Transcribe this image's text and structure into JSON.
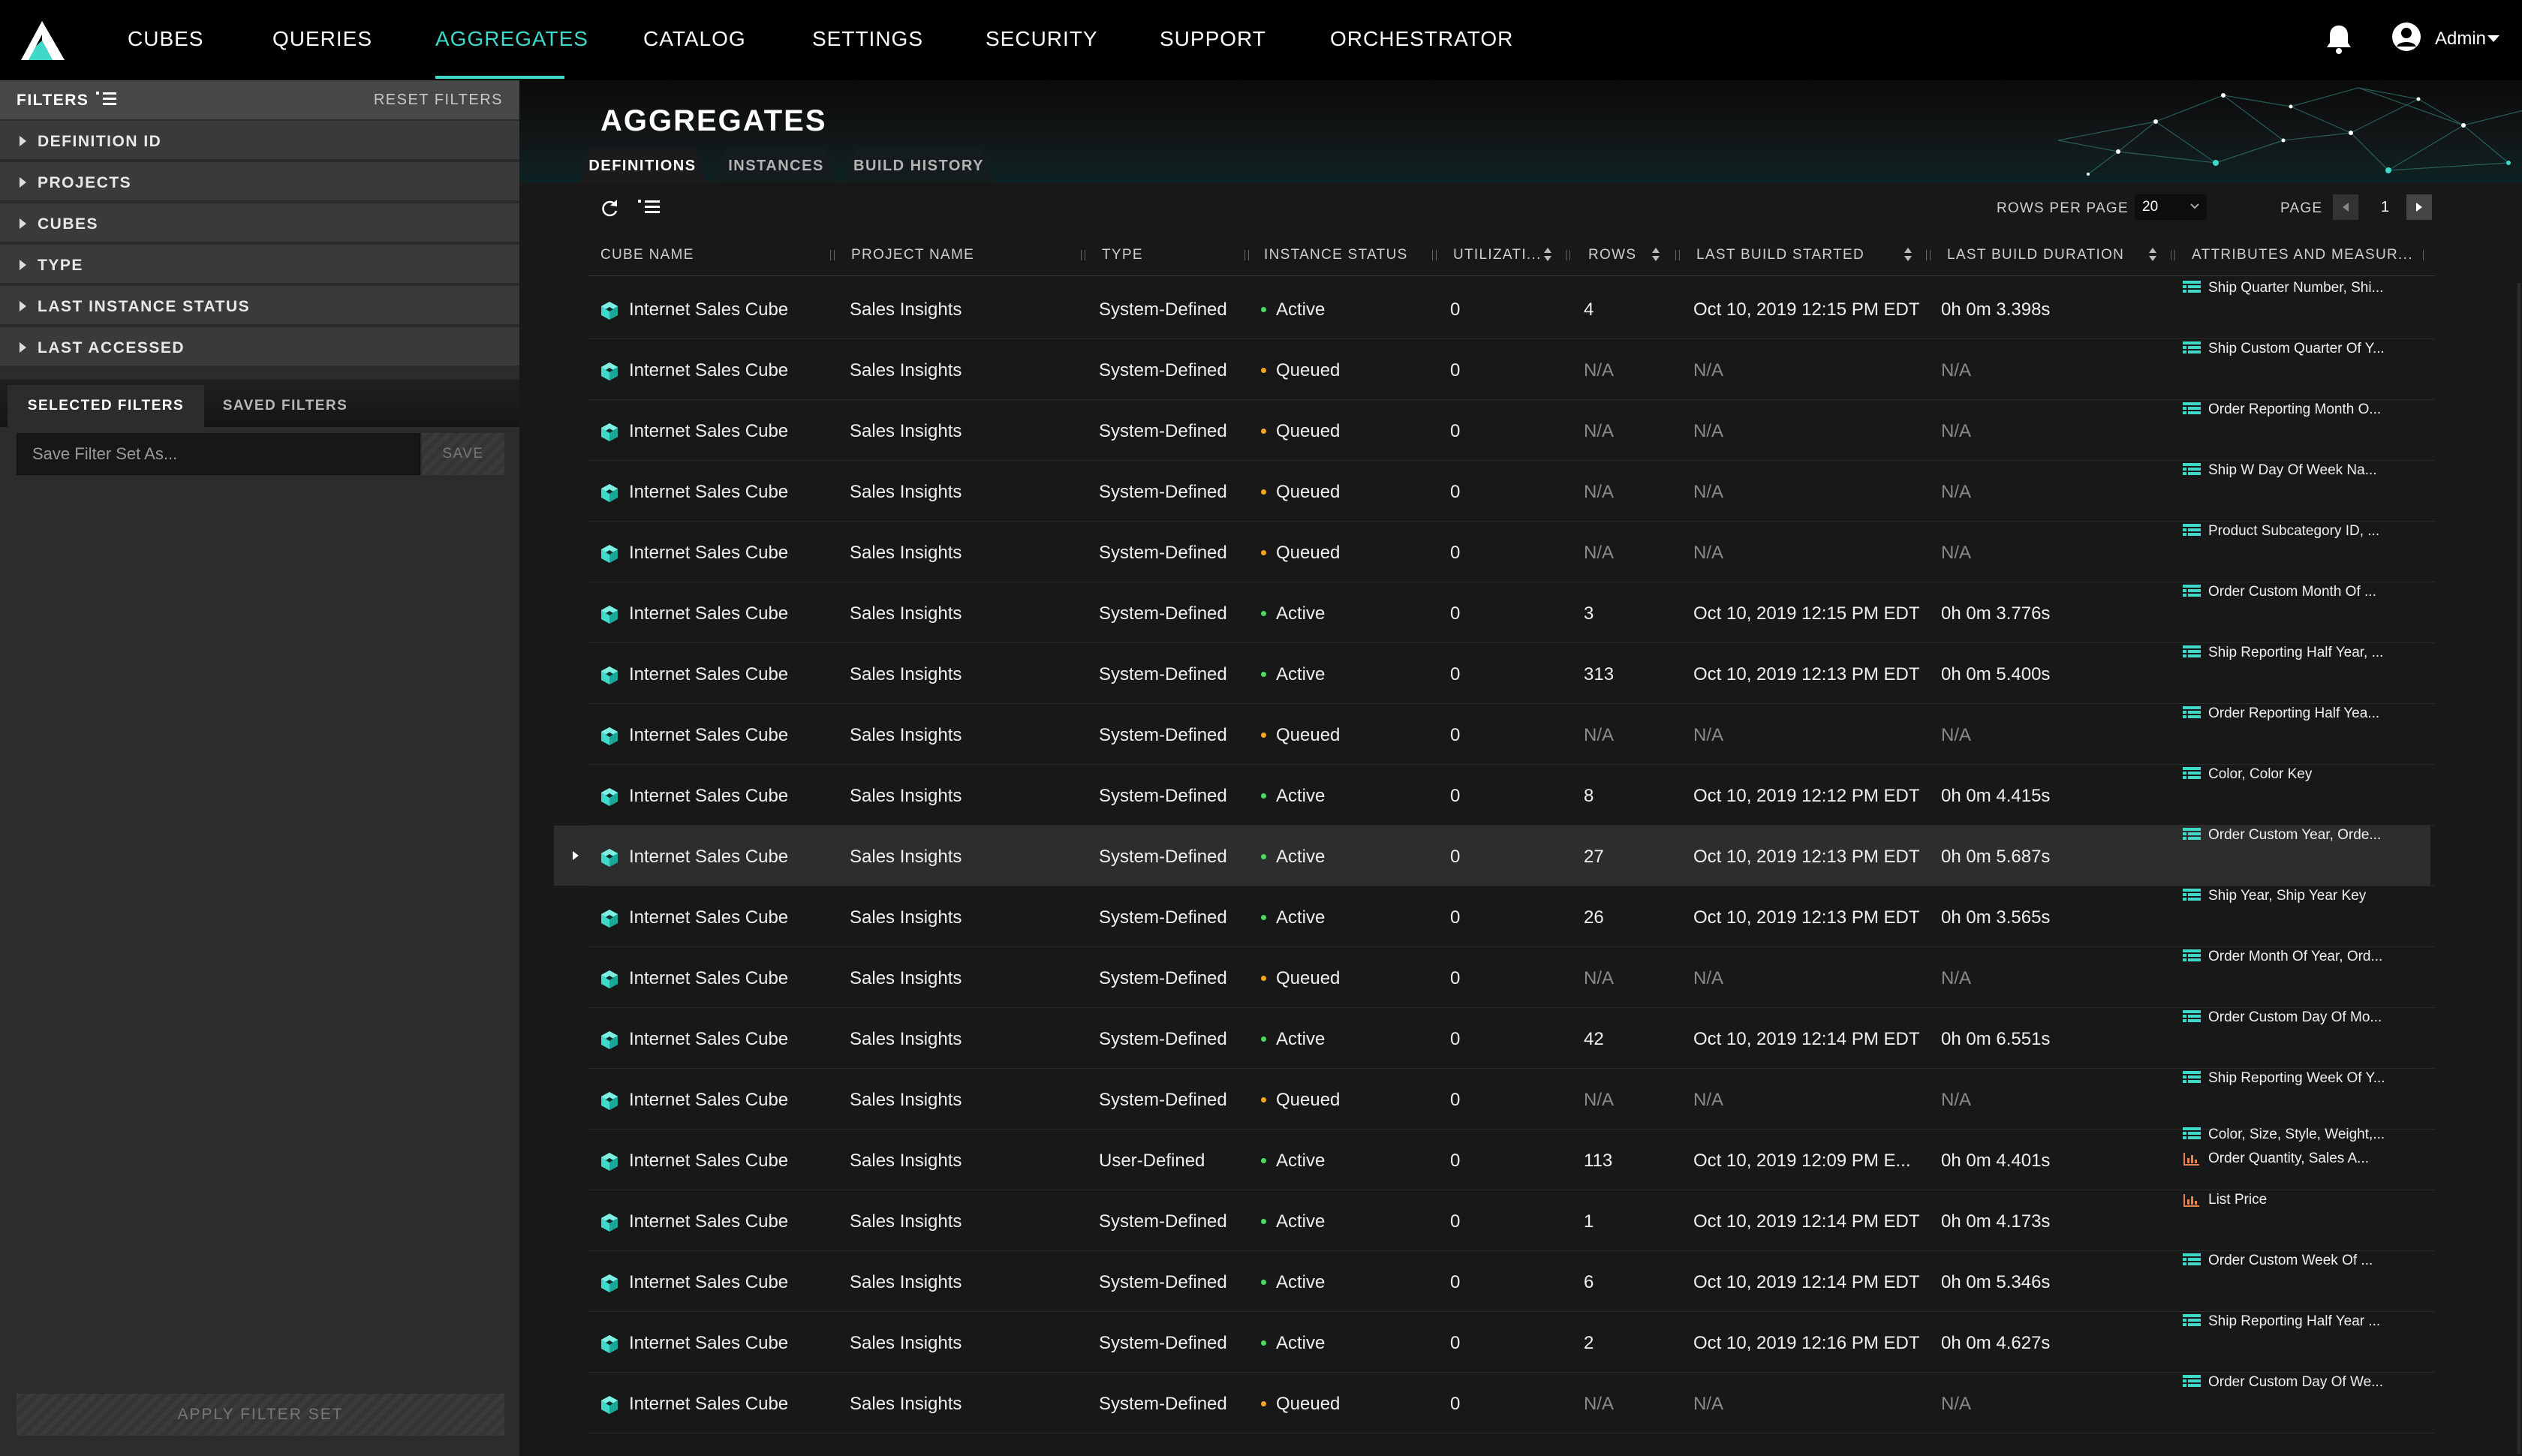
{
  "colors": {
    "accent": "#3ed9c8",
    "active": "#4cd964",
    "queued": "#f5a623",
    "measure": "#e8844a"
  },
  "nav": {
    "items": [
      {
        "label": "CUBES",
        "name": "nav-cubes"
      },
      {
        "label": "QUERIES",
        "name": "nav-queries"
      },
      {
        "label": "AGGREGATES",
        "name": "nav-aggregates",
        "active": true
      },
      {
        "label": "CATALOG",
        "name": "nav-catalog"
      },
      {
        "label": "SETTINGS",
        "name": "nav-settings"
      },
      {
        "label": "SECURITY",
        "name": "nav-security"
      },
      {
        "label": "SUPPORT",
        "name": "nav-support"
      },
      {
        "label": "ORCHESTRATOR",
        "name": "nav-orchestrator"
      }
    ],
    "user": "Admin",
    "icons": [
      "logo-icon",
      "bell-icon",
      "user-icon",
      "caret-down-icon"
    ]
  },
  "sidebar": {
    "title": "FILTERS",
    "reset": "RESET FILTERS",
    "filters": [
      "DEFINITION ID",
      "PROJECTS",
      "CUBES",
      "TYPE",
      "LAST INSTANCE STATUS",
      "LAST ACCESSED"
    ],
    "tabs": [
      "SELECTED FILTERS",
      "SAVED FILTERS"
    ],
    "save_placeholder": "Save Filter Set As...",
    "save_label": "SAVE",
    "apply_label": "APPLY FILTER SET"
  },
  "main": {
    "title": "AGGREGATES",
    "tabs": [
      "DEFINITIONS",
      "INSTANCES",
      "BUILD HISTORY"
    ],
    "rows_per_page_label": "ROWS PER PAGE",
    "rows_per_page": "20",
    "page_label": "PAGE",
    "page": "1"
  },
  "table": {
    "columns": [
      "CUBE NAME",
      "PROJECT NAME",
      "TYPE",
      "INSTANCE STATUS",
      "UTILIZATI...",
      "ROWS",
      "LAST BUILD STARTED",
      "LAST BUILD DURATION",
      "ATTRIBUTES AND MEASUR..."
    ],
    "rows": [
      {
        "cube": "Internet Sales Cube",
        "project": "Sales Insights",
        "type": "System-Defined",
        "status": "Active",
        "util": "0",
        "rows": "4",
        "started": "Oct 10, 2019 12:15 PM EDT",
        "duration": "0h 0m 3.398s",
        "attrs": [
          {
            "kind": "attr",
            "text": "Ship Quarter Number, Shi..."
          }
        ]
      },
      {
        "cube": "Internet Sales Cube",
        "project": "Sales Insights",
        "type": "System-Defined",
        "status": "Queued",
        "util": "0",
        "rows": "N/A",
        "started": "N/A",
        "duration": "N/A",
        "attrs": [
          {
            "kind": "attr",
            "text": "Ship Custom Quarter Of Y..."
          }
        ]
      },
      {
        "cube": "Internet Sales Cube",
        "project": "Sales Insights",
        "type": "System-Defined",
        "status": "Queued",
        "util": "0",
        "rows": "N/A",
        "started": "N/A",
        "duration": "N/A",
        "attrs": [
          {
            "kind": "attr",
            "text": "Order Reporting Month O..."
          }
        ]
      },
      {
        "cube": "Internet Sales Cube",
        "project": "Sales Insights",
        "type": "System-Defined",
        "status": "Queued",
        "util": "0",
        "rows": "N/A",
        "started": "N/A",
        "duration": "N/A",
        "attrs": [
          {
            "kind": "attr",
            "text": "Ship W Day Of Week Na..."
          }
        ]
      },
      {
        "cube": "Internet Sales Cube",
        "project": "Sales Insights",
        "type": "System-Defined",
        "status": "Queued",
        "util": "0",
        "rows": "N/A",
        "started": "N/A",
        "duration": "N/A",
        "attrs": [
          {
            "kind": "attr",
            "text": "Product Subcategory ID, ..."
          }
        ]
      },
      {
        "cube": "Internet Sales Cube",
        "project": "Sales Insights",
        "type": "System-Defined",
        "status": "Active",
        "util": "0",
        "rows": "3",
        "started": "Oct 10, 2019 12:15 PM EDT",
        "duration": "0h 0m 3.776s",
        "attrs": [
          {
            "kind": "attr",
            "text": "Order Custom Month Of ..."
          }
        ]
      },
      {
        "cube": "Internet Sales Cube",
        "project": "Sales Insights",
        "type": "System-Defined",
        "status": "Active",
        "util": "0",
        "rows": "313",
        "started": "Oct 10, 2019 12:13 PM EDT",
        "duration": "0h 0m 5.400s",
        "attrs": [
          {
            "kind": "attr",
            "text": "Ship Reporting Half Year, ..."
          }
        ]
      },
      {
        "cube": "Internet Sales Cube",
        "project": "Sales Insights",
        "type": "System-Defined",
        "status": "Queued",
        "util": "0",
        "rows": "N/A",
        "started": "N/A",
        "duration": "N/A",
        "attrs": [
          {
            "kind": "attr",
            "text": "Order Reporting Half Yea..."
          }
        ]
      },
      {
        "cube": "Internet Sales Cube",
        "project": "Sales Insights",
        "type": "System-Defined",
        "status": "Active",
        "util": "0",
        "rows": "8",
        "started": "Oct 10, 2019 12:12 PM EDT",
        "duration": "0h 0m 4.415s",
        "attrs": [
          {
            "kind": "attr",
            "text": "Color, Color Key"
          }
        ]
      },
      {
        "cube": "Internet Sales Cube",
        "project": "Sales Insights",
        "type": "System-Defined",
        "status": "Active",
        "util": "0",
        "rows": "27",
        "started": "Oct 10, 2019 12:13 PM EDT",
        "duration": "0h 0m 5.687s",
        "selected": true,
        "attrs": [
          {
            "kind": "attr",
            "text": "Order Custom Year, Orde..."
          }
        ]
      },
      {
        "cube": "Internet Sales Cube",
        "project": "Sales Insights",
        "type": "System-Defined",
        "status": "Active",
        "util": "0",
        "rows": "26",
        "started": "Oct 10, 2019 12:13 PM EDT",
        "duration": "0h 0m 3.565s",
        "attrs": [
          {
            "kind": "attr",
            "text": "Ship Year, Ship Year Key"
          }
        ]
      },
      {
        "cube": "Internet Sales Cube",
        "project": "Sales Insights",
        "type": "System-Defined",
        "status": "Queued",
        "util": "0",
        "rows": "N/A",
        "started": "N/A",
        "duration": "N/A",
        "attrs": [
          {
            "kind": "attr",
            "text": "Order Month Of Year, Ord..."
          }
        ]
      },
      {
        "cube": "Internet Sales Cube",
        "project": "Sales Insights",
        "type": "System-Defined",
        "status": "Active",
        "util": "0",
        "rows": "42",
        "started": "Oct 10, 2019 12:14 PM EDT",
        "duration": "0h 0m 6.551s",
        "attrs": [
          {
            "kind": "attr",
            "text": "Order Custom Day Of Mo..."
          }
        ]
      },
      {
        "cube": "Internet Sales Cube",
        "project": "Sales Insights",
        "type": "System-Defined",
        "status": "Queued",
        "util": "0",
        "rows": "N/A",
        "started": "N/A",
        "duration": "N/A",
        "attrs": [
          {
            "kind": "attr",
            "text": "Ship Reporting Week Of Y..."
          }
        ]
      },
      {
        "cube": "Internet Sales Cube",
        "project": "Sales Insights",
        "type": "User-Defined",
        "status": "Active",
        "util": "0",
        "rows": "113",
        "started": "Oct 10, 2019 12:09 PM E...",
        "duration": "0h 0m 4.401s",
        "attrs": [
          {
            "kind": "attr",
            "text": "Color, Size, Style, Weight,..."
          },
          {
            "kind": "measure",
            "text": "Order Quantity, Sales A..."
          }
        ]
      },
      {
        "cube": "Internet Sales Cube",
        "project": "Sales Insights",
        "type": "System-Defined",
        "status": "Active",
        "util": "0",
        "rows": "1",
        "started": "Oct 10, 2019 12:14 PM EDT",
        "duration": "0h 0m 4.173s",
        "attrs": [
          {
            "kind": "measure",
            "text": "List Price"
          }
        ]
      },
      {
        "cube": "Internet Sales Cube",
        "project": "Sales Insights",
        "type": "System-Defined",
        "status": "Active",
        "util": "0",
        "rows": "6",
        "started": "Oct 10, 2019 12:14 PM EDT",
        "duration": "0h 0m 5.346s",
        "attrs": [
          {
            "kind": "attr",
            "text": "Order Custom Week Of ..."
          }
        ]
      },
      {
        "cube": "Internet Sales Cube",
        "project": "Sales Insights",
        "type": "System-Defined",
        "status": "Active",
        "util": "0",
        "rows": "2",
        "started": "Oct 10, 2019 12:16 PM EDT",
        "duration": "0h 0m 4.627s",
        "attrs": [
          {
            "kind": "attr",
            "text": "Ship Reporting Half Year ..."
          }
        ]
      },
      {
        "cube": "Internet Sales Cube",
        "project": "Sales Insights",
        "type": "System-Defined",
        "status": "Queued",
        "util": "0",
        "rows": "N/A",
        "started": "N/A",
        "duration": "N/A",
        "attrs": [
          {
            "kind": "attr",
            "text": "Order Custom Day Of We..."
          }
        ]
      }
    ]
  }
}
